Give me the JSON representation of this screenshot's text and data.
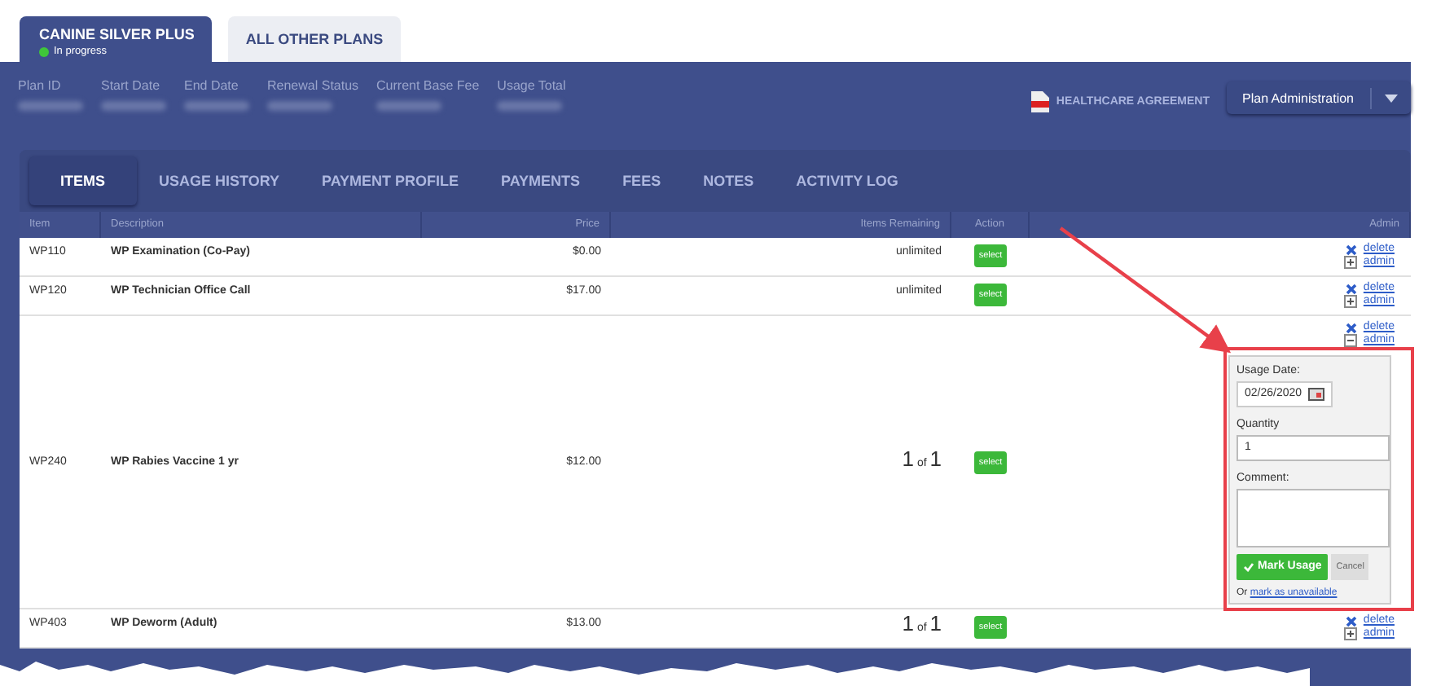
{
  "plan_tabs": [
    {
      "label": "CANINE SILVER PLUS",
      "selected": true,
      "status": {
        "text": "In progress",
        "color": "#3fc53a"
      }
    },
    {
      "label": "ALL OTHER PLANS",
      "selected": false
    }
  ],
  "plan_fields": [
    {
      "label": "Plan ID"
    },
    {
      "label": "Start Date"
    },
    {
      "label": "End Date"
    },
    {
      "label": "Renewal Status"
    },
    {
      "label": "Current Base Fee"
    },
    {
      "label": "Usage Total"
    }
  ],
  "agreement_link": "HEALTHCARE AGREEMENT",
  "admin_menu": {
    "label": "Plan Administration"
  },
  "nav_tabs": [
    {
      "label": "ITEMS",
      "selected": true
    },
    {
      "label": "USAGE HISTORY",
      "selected": false
    },
    {
      "label": "PAYMENT PROFILE",
      "selected": false
    },
    {
      "label": "PAYMENTS",
      "selected": false
    },
    {
      "label": "FEES",
      "selected": false
    },
    {
      "label": "NOTES",
      "selected": false
    },
    {
      "label": "ACTIVITY LOG",
      "selected": false
    }
  ],
  "table": {
    "columns": [
      "Item",
      "Description",
      "Price",
      "Items Remaining",
      "Action",
      "Admin"
    ],
    "rows": [
      {
        "item": "WP110",
        "description": "WP Examination (Co-Pay)",
        "price": "$0.00",
        "remaining": {
          "kind": "text",
          "text": "unlimited"
        },
        "action": "select",
        "delete": "delete",
        "admin": "admin",
        "expanded": false
      },
      {
        "item": "WP120",
        "description": "WP Technician Office Call",
        "price": "$17.00",
        "remaining": {
          "kind": "text",
          "text": "unlimited"
        },
        "action": "select",
        "delete": "delete",
        "admin": "admin",
        "expanded": false
      },
      {
        "item": "WP240",
        "description": "WP Rabies Vaccine 1 yr",
        "price": "$12.00",
        "remaining": {
          "kind": "count",
          "used": "1",
          "word": "of",
          "total": "1"
        },
        "action": "select",
        "delete": "delete",
        "admin": "admin",
        "expanded": true,
        "form": {
          "date_label": "Usage Date:",
          "date": "02/26/2020",
          "quantity_label": "Quantity",
          "quantity": "1",
          "comment_label": "Comment:",
          "submit": "Mark Usage",
          "cancel": "Cancel",
          "or": "Or",
          "unavailable_link": "mark as unavailable"
        }
      },
      {
        "item": "WP403",
        "description": "WP Deworm (Adult)",
        "price": "$13.00",
        "remaining": {
          "kind": "count",
          "used": "1",
          "word": "of",
          "total": "1"
        },
        "action": "select",
        "delete": "delete",
        "admin": "admin",
        "expanded": false
      }
    ]
  }
}
